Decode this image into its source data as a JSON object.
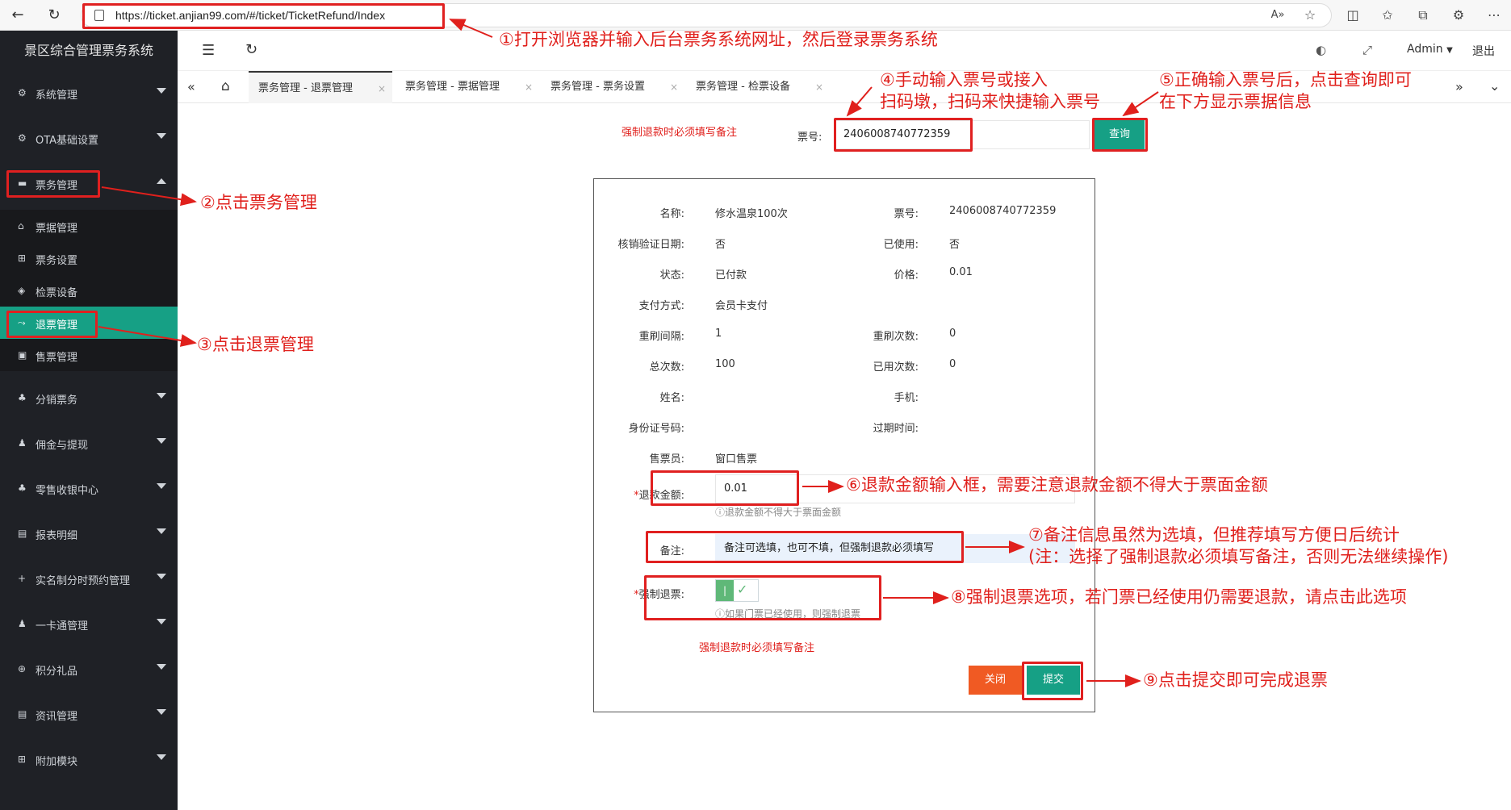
{
  "browser": {
    "url": "https://ticket.anjian99.com/#/ticket/TicketRefund/Index"
  },
  "sidebar": {
    "brand": "景区综合管理票务系统",
    "items": [
      {
        "label": "系统管理",
        "icon": "gear-icon"
      },
      {
        "label": "OTA基础设置",
        "icon": "gear-icon"
      },
      {
        "label": "票务管理",
        "icon": "ticket-icon"
      },
      {
        "label": "分销票务",
        "icon": "share-icon"
      },
      {
        "label": "佣金与提现",
        "icon": "users-icon"
      },
      {
        "label": "零售收银中心",
        "icon": "shop-icon"
      },
      {
        "label": "报表明细",
        "icon": "report-icon"
      },
      {
        "label": "实名制分时预约管理",
        "icon": "plus-icon"
      },
      {
        "label": "一卡通管理",
        "icon": "users-icon"
      },
      {
        "label": "积分礼品",
        "icon": "gift-icon"
      },
      {
        "label": "资讯管理",
        "icon": "news-icon"
      },
      {
        "label": "附加模块",
        "icon": "module-icon"
      }
    ],
    "sub_items": [
      {
        "label": "票据管理",
        "icon": "tag-icon"
      },
      {
        "label": "票务设置",
        "icon": "settings-icon"
      },
      {
        "label": "检票设备",
        "icon": "shield-icon"
      },
      {
        "label": "退票管理",
        "icon": "refund-icon"
      },
      {
        "label": "售票管理",
        "icon": "sale-icon"
      }
    ]
  },
  "header": {
    "user": "Admin",
    "logout": "退出"
  },
  "tabs": [
    {
      "label": "票务管理 - 退票管理"
    },
    {
      "label": "票务管理 - 票据管理"
    },
    {
      "label": "票务管理 - 票务设置"
    },
    {
      "label": "票务管理 - 检票设备"
    }
  ],
  "search": {
    "warning": "强制退款时必须填写备注",
    "label": "票号:",
    "value": "2406008740772359",
    "button": "查询"
  },
  "ticket": {
    "name_label": "名称:",
    "name": "修水温泉100次",
    "no_label": "票号:",
    "no": "2406008740772359",
    "verify_date_label": "核销验证日期:",
    "verify_date": "否",
    "used_label": "已使用:",
    "used": "否",
    "status_label": "状态:",
    "status": "已付款",
    "price_label": "价格:",
    "price": "0.01",
    "pay_label": "支付方式:",
    "pay": "会员卡支付",
    "interval_label": "重刷间隔:",
    "interval": "1",
    "rescan_label": "重刷次数:",
    "rescan": "0",
    "total_label": "总次数:",
    "total": "100",
    "used_count_label": "已用次数:",
    "used_count": "0",
    "person_label": "姓名:",
    "phone_label": "手机:",
    "idcard_label": "身份证号码:",
    "expire_label": "过期时间:",
    "seller_label": "售票员:",
    "seller": "窗口售票"
  },
  "refund": {
    "amount_label": "退款金额:",
    "amount": "0.01",
    "amount_hint": "ⓘ退款金额不得大于票面金额",
    "note_label": "备注:",
    "note": "备注可选填，也可不填，但强制退款必须填写",
    "force_label": "强制退票:",
    "force_hint": "ⓘ如果门票已经使用，则强制退票",
    "warning": "强制退款时必须填写备注",
    "close": "关闭",
    "submit": "提交"
  },
  "annotations": {
    "a1": "①打开浏览器并输入后台票务系统网址，然后登录票务系统",
    "a2": "②点击票务管理",
    "a3": "③点击退票管理",
    "a4_1": "④手动输入票号或接入",
    "a4_2": "扫码墩，扫码来快捷输入票号",
    "a5_1": "⑤正确输入票号后，点击查询即可",
    "a5_2": "在下方显示票据信息",
    "a6": "⑥退款金额输入框，需要注意退款金额不得大于票面金额",
    "a7_1": "⑦备注信息虽然为选填，但推荐填写方便日后统计",
    "a7_2": "(注：选择了强制退款必须填写备注，否则无法继续操作)",
    "a8": "⑧强制退票选项，若门票已经使用仍需要退款，请点击此选项",
    "a9": "⑨点击提交即可完成退票"
  },
  "colors": {
    "accent": "#16a085",
    "annotation": "#e0201c",
    "close_btn": "#f05a23"
  }
}
